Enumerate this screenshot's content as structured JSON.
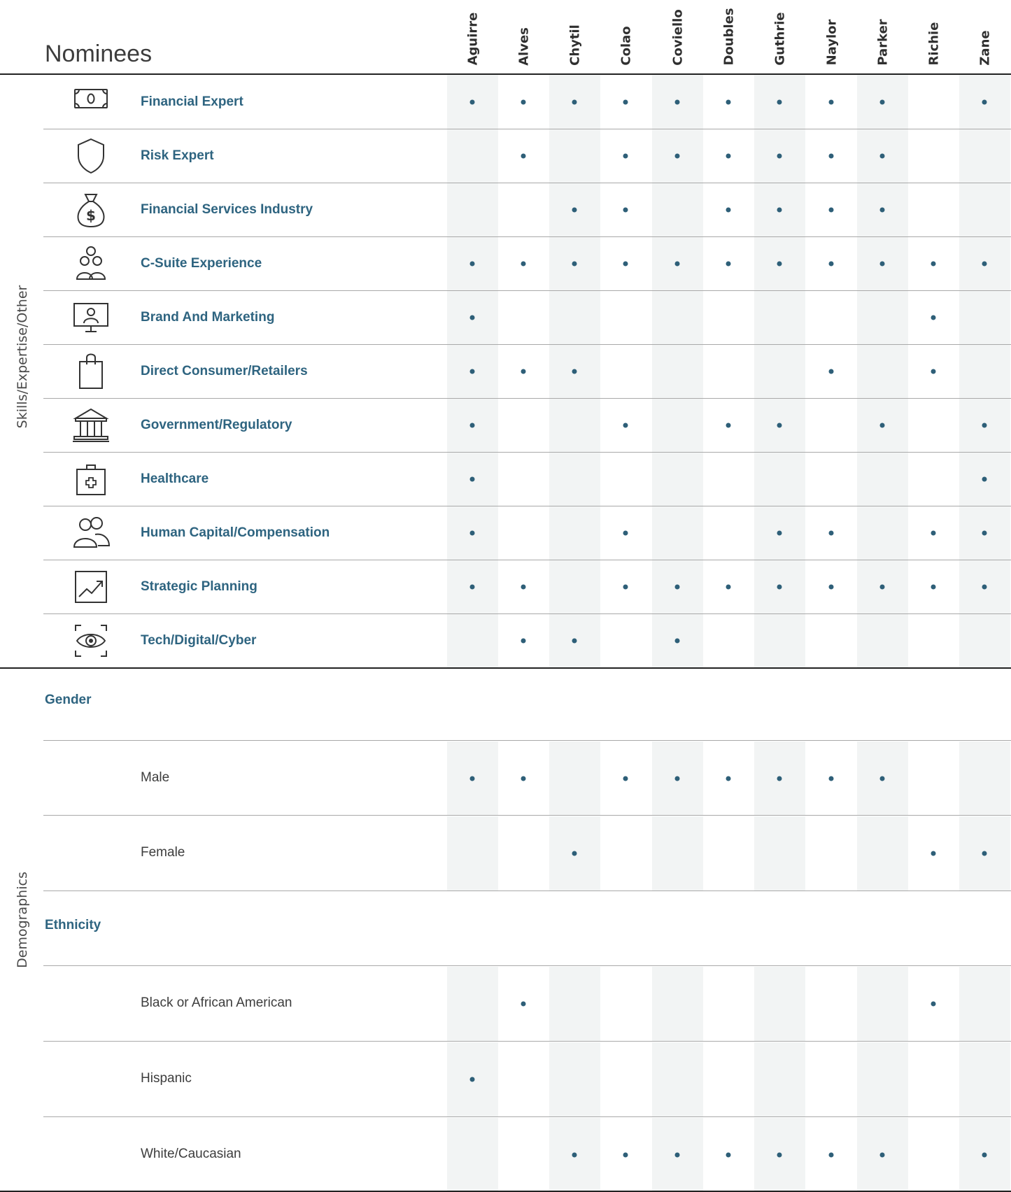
{
  "title": "Nominees",
  "nominees": [
    "Aguirre",
    "Alves",
    "Chytil",
    "Colao",
    "Coviello",
    "Doubles",
    "Guthrie",
    "Naylor",
    "Parker",
    "Richie",
    "Zane"
  ],
  "groups": {
    "skills": "Skills/Expertise/Other",
    "demographics": "Demographics"
  },
  "skills": [
    {
      "label": "Financial Expert",
      "icon": "money-bill-icon",
      "checks": [
        1,
        1,
        1,
        1,
        1,
        1,
        1,
        1,
        1,
        0,
        1
      ]
    },
    {
      "label": "Risk Expert",
      "icon": "shield-icon",
      "checks": [
        0,
        1,
        0,
        1,
        1,
        1,
        1,
        1,
        1,
        0,
        0
      ]
    },
    {
      "label": "Financial Services Industry",
      "icon": "money-bag-icon",
      "checks": [
        0,
        0,
        1,
        1,
        0,
        1,
        1,
        1,
        1,
        0,
        0
      ]
    },
    {
      "label": "C-Suite Experience",
      "icon": "people-group-icon",
      "checks": [
        1,
        1,
        1,
        1,
        1,
        1,
        1,
        1,
        1,
        1,
        1
      ]
    },
    {
      "label": "Brand And Marketing",
      "icon": "monitor-person-icon",
      "checks": [
        1,
        0,
        0,
        0,
        0,
        0,
        0,
        0,
        0,
        1,
        0
      ]
    },
    {
      "label": "Direct Consumer/Retailers",
      "icon": "shopping-bag-icon",
      "checks": [
        1,
        1,
        1,
        0,
        0,
        0,
        0,
        1,
        0,
        1,
        0
      ]
    },
    {
      "label": "Government/Regulatory",
      "icon": "government-building-icon",
      "checks": [
        1,
        0,
        0,
        1,
        0,
        1,
        1,
        0,
        1,
        0,
        1
      ]
    },
    {
      "label": "Healthcare",
      "icon": "medical-kit-icon",
      "checks": [
        1,
        0,
        0,
        0,
        0,
        0,
        0,
        0,
        0,
        0,
        1
      ]
    },
    {
      "label": "Human Capital/Compensation",
      "icon": "two-people-icon",
      "checks": [
        1,
        0,
        0,
        1,
        0,
        0,
        1,
        1,
        0,
        1,
        1
      ]
    },
    {
      "label": "Strategic Planning",
      "icon": "trend-chart-icon",
      "checks": [
        1,
        1,
        0,
        1,
        1,
        1,
        1,
        1,
        1,
        1,
        1
      ]
    },
    {
      "label": "Tech/Digital/Cyber",
      "icon": "eye-scan-icon",
      "checks": [
        0,
        1,
        1,
        0,
        1,
        0,
        0,
        0,
        0,
        0,
        0
      ]
    }
  ],
  "demographics": {
    "gender": {
      "heading": "Gender",
      "rows": [
        {
          "label": "Male",
          "checks": [
            1,
            1,
            0,
            1,
            1,
            1,
            1,
            1,
            1,
            0,
            0
          ]
        },
        {
          "label": "Female",
          "checks": [
            0,
            0,
            1,
            0,
            0,
            0,
            0,
            0,
            0,
            1,
            1
          ]
        }
      ]
    },
    "ethnicity": {
      "heading": "Ethnicity",
      "rows": [
        {
          "label": "Black or African American",
          "checks": [
            0,
            1,
            0,
            0,
            0,
            0,
            0,
            0,
            0,
            1,
            0
          ]
        },
        {
          "label": "Hispanic",
          "checks": [
            1,
            0,
            0,
            0,
            0,
            0,
            0,
            0,
            0,
            0,
            0
          ]
        },
        {
          "label": "White/Caucasian",
          "checks": [
            0,
            0,
            1,
            1,
            1,
            1,
            1,
            1,
            1,
            0,
            1
          ]
        }
      ]
    }
  },
  "colors": {
    "label": "#2e6480",
    "dot": "#2e5f78",
    "band": "#f2f4f4"
  }
}
